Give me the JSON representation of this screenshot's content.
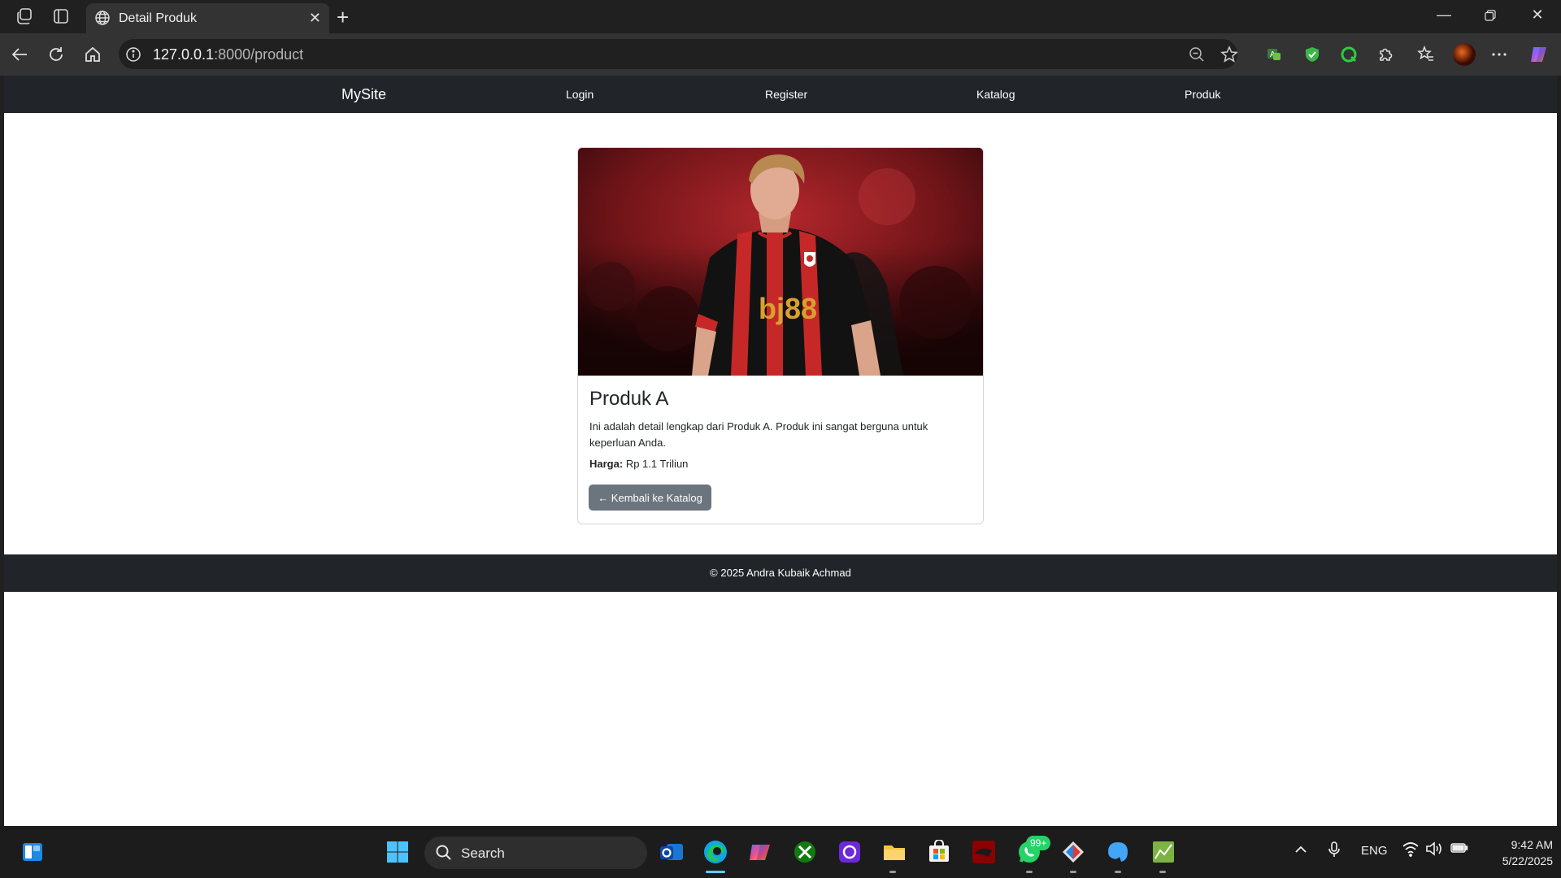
{
  "browser": {
    "tab_title": "Detail Produk",
    "url_host": "127.0.0.1",
    "url_rest": ":8000/product"
  },
  "site": {
    "brand": "MySite",
    "nav": [
      "Login",
      "Register",
      "Katalog",
      "Produk"
    ],
    "product": {
      "name": "Produk A",
      "description": "Ini adalah detail lengkap dari Produk A. Produk ini sangat berguna untuk keperluan Anda.",
      "price_label": "Harga:",
      "price_value": "Rp 1.1 Triliun",
      "back_button": "← Kembali ke Katalog",
      "jersey_text": "bj88"
    },
    "footer": "© 2025 Andra Kubaik Achmad"
  },
  "taskbar": {
    "search_label": "Search",
    "whatsapp_badge": "99+",
    "language": "ENG",
    "time": "9:42 AM",
    "date": "5/22/2025"
  },
  "colors": {
    "navbar": "#212529",
    "button_secondary": "#6c757d",
    "browser_frame": "#202020",
    "toolbar": "#333333"
  }
}
